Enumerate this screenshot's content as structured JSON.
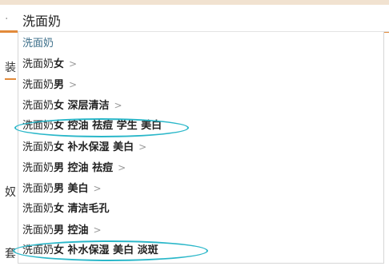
{
  "search": {
    "query": "洗面奶"
  },
  "background": {
    "fragments": [
      "·",
      "装",
      "奴",
      "套"
    ]
  },
  "suggestions": [
    {
      "base": "洗面奶",
      "keywords": "",
      "chevron": false
    },
    {
      "base": "洗面奶",
      "keywords": "女",
      "chevron": true
    },
    {
      "base": "洗面奶",
      "keywords": "男",
      "chevron": true
    },
    {
      "base": "洗面奶",
      "keywords": "女 深层清洁",
      "chevron": true
    },
    {
      "base": "洗面奶",
      "keywords": "女 控油 祛痘 学生 美白",
      "chevron": false
    },
    {
      "base": "洗面奶",
      "keywords": "女 补水保湿 美白",
      "chevron": true
    },
    {
      "base": "洗面奶",
      "keywords": "男 控油 祛痘",
      "chevron": true
    },
    {
      "base": "洗面奶",
      "keywords": "男 美白",
      "chevron": true
    },
    {
      "base": "洗面奶",
      "keywords": "女 清洁毛孔",
      "chevron": false
    },
    {
      "base": "洗面奶",
      "keywords": "男 控油",
      "chevron": true
    },
    {
      "base": "洗面奶",
      "keywords": "女 补水保湿 美白 淡斑",
      "chevron": false
    }
  ],
  "chevron_glyph": ">",
  "colors": {
    "highlight_ellipse": "#2ab7c9",
    "accent_bar": "#e28a3a",
    "first_item_text": "#3d6f8a"
  }
}
